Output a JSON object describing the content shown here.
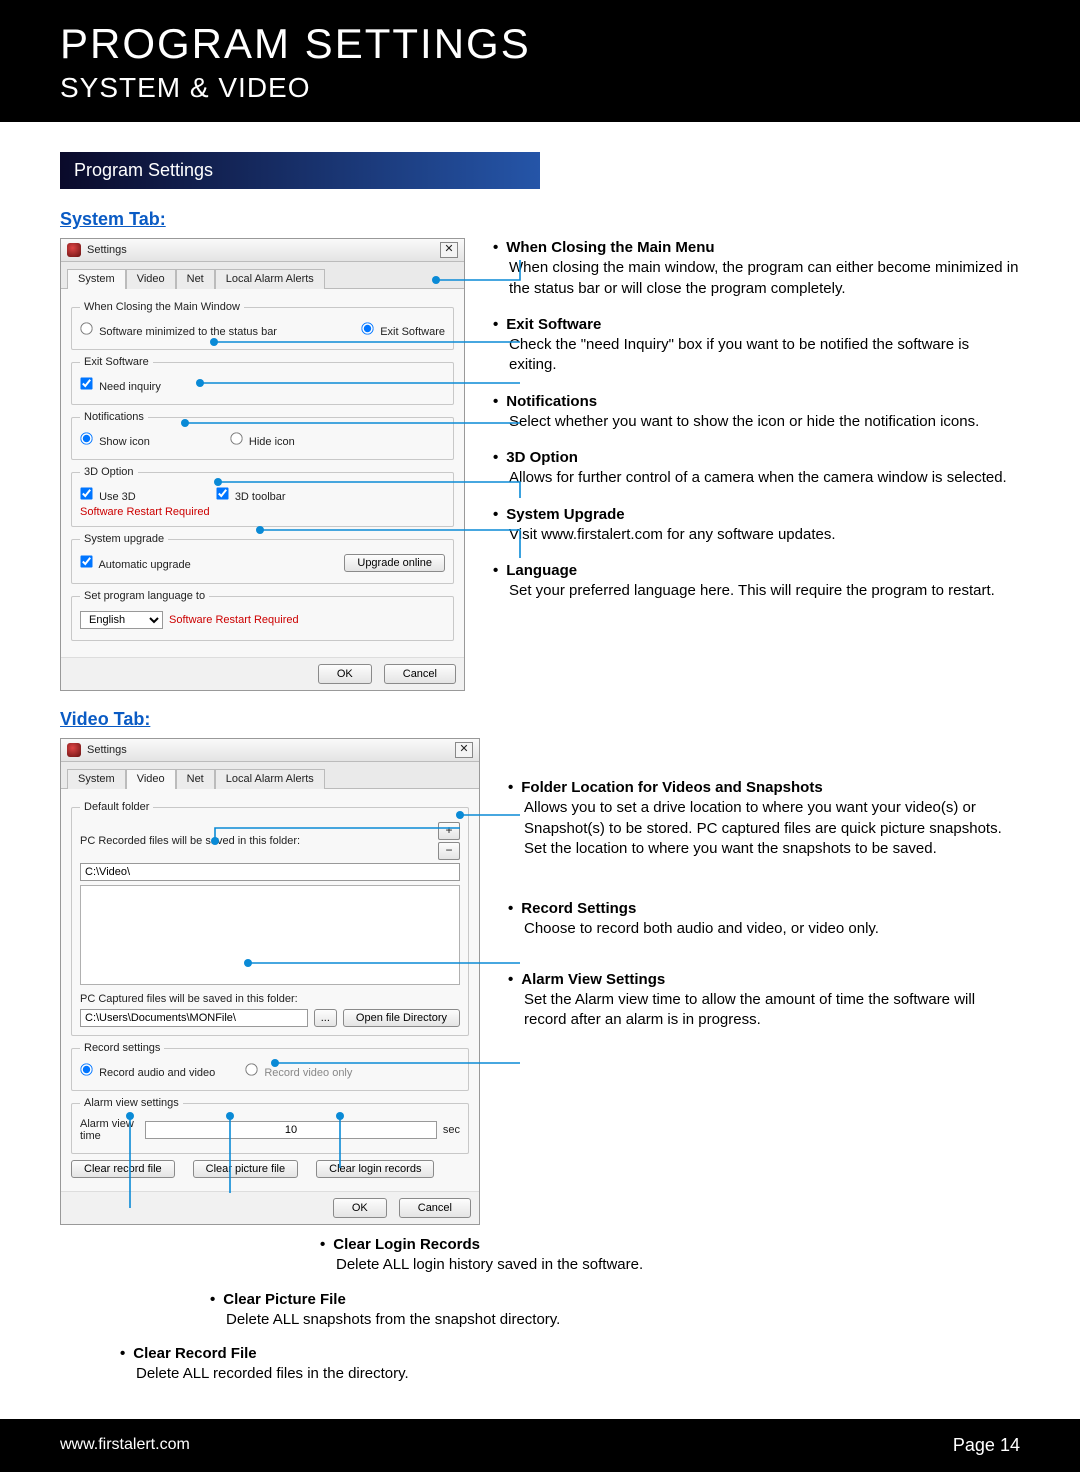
{
  "header": {
    "title": "PROGRAM SETTINGS",
    "subtitle": "SYSTEM & VIDEO"
  },
  "banner": "Program Settings",
  "section1_title": "System Tab:",
  "section2_title": "Video Tab:",
  "dialog": {
    "title": "Settings",
    "close": "✕",
    "tabs": [
      "System",
      "Video",
      "Net",
      "Local Alarm Alerts"
    ],
    "system": {
      "group_close": "When Closing the Main Window",
      "opt_minimize": "Software minimized to the status bar",
      "opt_exit": "Exit Software",
      "group_exit": "Exit Software",
      "chk_need_inquiry": "Need inquiry",
      "group_notif": "Notifications",
      "opt_show_icon": "Show icon",
      "opt_hide_icon": "Hide icon",
      "group_3d": "3D Option",
      "chk_use3d": "Use 3D",
      "chk_3dtoolbar": "3D toolbar",
      "restart_req": "Software Restart Required",
      "group_upgrade": "System upgrade",
      "chk_auto_upgrade": "Automatic upgrade",
      "btn_upgrade": "Upgrade online",
      "group_lang": "Set program language to",
      "lang_value": "English",
      "restart_req2": "Software Restart Required",
      "ok": "OK",
      "cancel": "Cancel"
    },
    "video": {
      "group_default": "Default folder",
      "lbl_recorded": "PC Recorded files will be saved in this folder:",
      "path_recorded": "C:\\Video\\",
      "lbl_captured": "PC Captured files will be saved in this folder:",
      "path_captured": "C:\\Users\\Documents\\MONFile\\",
      "btn_browse": "...",
      "btn_open_dir": "Open file Directory",
      "group_record": "Record settings",
      "opt_rec_av": "Record audio and video",
      "opt_rec_v": "Record video only",
      "group_alarm": "Alarm view settings",
      "lbl_alarm_time": "Alarm view time",
      "alarm_value": "10",
      "lbl_sec": "sec",
      "btn_clear_rec": "Clear record file",
      "btn_clear_pic": "Clear picture file",
      "btn_clear_login": "Clear login records"
    }
  },
  "callouts_system": [
    {
      "title": "When Closing the Main Menu",
      "desc": "When closing the main window, the program can either become minimized in the status bar or will close the program completely."
    },
    {
      "title": "Exit Software",
      "desc": "Check the \"need Inquiry\" box if you want to be notified the software is exiting."
    },
    {
      "title": "Notifications",
      "desc": "Select whether you want to show the icon or hide the notification icons."
    },
    {
      "title": "3D Option",
      "desc": "Allows for further control of a camera when the camera window is selected."
    },
    {
      "title": "System Upgrade",
      "desc": "Visit www.firstalert.com for any software updates."
    },
    {
      "title": "Language",
      "desc": "Set your preferred language here. This will require the program to restart."
    }
  ],
  "callouts_video_right": [
    {
      "title": "Folder Location for Videos and Snapshots",
      "desc": "Allows you to set a drive location to where you want your video(s) or Snapshot(s) to be stored. PC captured files are quick picture snapshots. Set the location to where you want the snapshots to be saved."
    },
    {
      "title": "Record Settings",
      "desc": "Choose to record both audio and video, or video only."
    },
    {
      "title": "Alarm View Settings",
      "desc": "Set the Alarm view time to allow the amount of time the software will record after an alarm is in progress."
    }
  ],
  "callouts_video_bottom": [
    {
      "title": "Clear Login Records",
      "desc": "Delete ALL login history saved in the software."
    },
    {
      "title": "Clear Picture File",
      "desc": "Delete ALL snapshots from the snapshot directory."
    },
    {
      "title": "Clear Record File",
      "desc": "Delete ALL recorded files in the directory."
    }
  ],
  "footer": {
    "url": "www.firstalert.com",
    "page_label": "Page",
    "page_num": "14"
  }
}
